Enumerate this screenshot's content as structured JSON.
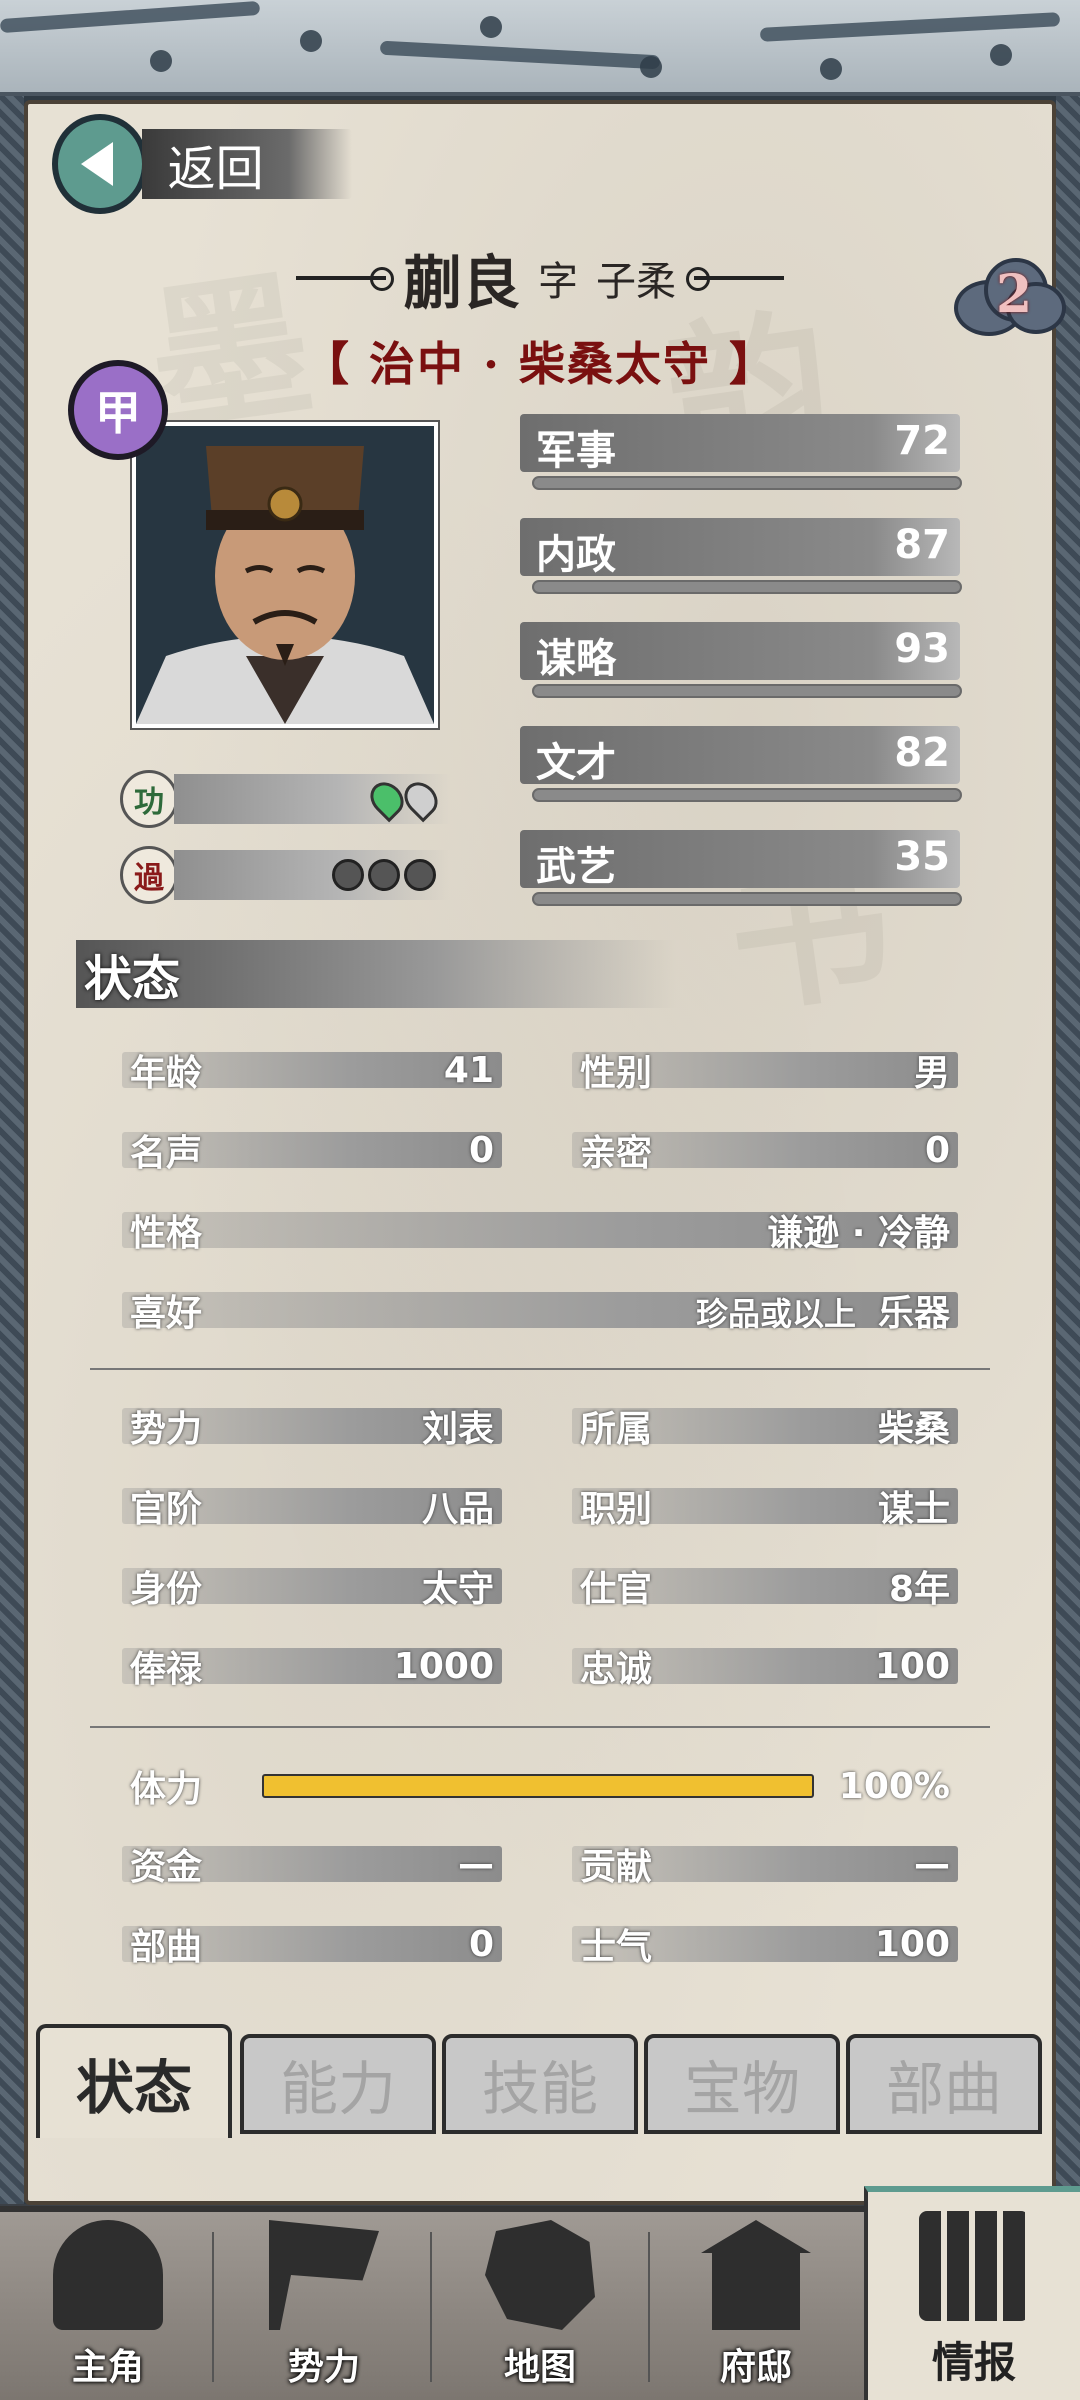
{
  "back_label": "返回",
  "officer": {
    "name": "蒯良",
    "courtesy_prefix": "字",
    "courtesy_name": "子柔",
    "title": "【 治中 · 柴桑太守 】",
    "grade": "甲",
    "badge_count": "2"
  },
  "merit": {
    "label": "功",
    "pins": [
      "green-pin-icon",
      "gray-pin-icon"
    ]
  },
  "demerit": {
    "label": "過",
    "marks": [
      "swirl-icon",
      "swirl-icon",
      "swirl-icon"
    ]
  },
  "abilities": [
    {
      "label": "军事",
      "value": "72"
    },
    {
      "label": "内政",
      "value": "87"
    },
    {
      "label": "谋略",
      "value": "93"
    },
    {
      "label": "文才",
      "value": "82"
    },
    {
      "label": "武艺",
      "value": "35"
    }
  ],
  "status_heading": "状态",
  "status": {
    "age": {
      "label": "年龄",
      "value": "41"
    },
    "gender": {
      "label": "性别",
      "value": "男"
    },
    "fame": {
      "label": "名声",
      "value": "0"
    },
    "intimacy": {
      "label": "亲密",
      "value": "0"
    },
    "personality": {
      "label": "性格",
      "value": "谦逊 · 冷静"
    },
    "hobby": {
      "label": "喜好",
      "value_prefix": "珍品或以上",
      "value": "乐器"
    },
    "faction": {
      "label": "势力",
      "value": "刘表"
    },
    "belong": {
      "label": "所属",
      "value": "柴桑"
    },
    "rank": {
      "label": "官阶",
      "value": "八品"
    },
    "post": {
      "label": "职别",
      "value": "谋士"
    },
    "identity": {
      "label": "身份",
      "value": "太守"
    },
    "service": {
      "label": "仕官",
      "value": "8年"
    },
    "salary": {
      "label": "俸禄",
      "value": "1000"
    },
    "loyalty": {
      "label": "忠诚",
      "value": "100"
    },
    "stamina": {
      "label": "体力",
      "value": "100%",
      "fraction": 1.0
    },
    "funds": {
      "label": "资金",
      "value": "—"
    },
    "contribution": {
      "label": "贡献",
      "value": "—"
    },
    "troops": {
      "label": "部曲",
      "value": "0"
    },
    "morale": {
      "label": "士气",
      "value": "100"
    }
  },
  "tabs": [
    "状态",
    "能力",
    "技能",
    "宝物",
    "部曲"
  ],
  "nav": [
    {
      "label": "主角",
      "icon": "warrior-icon"
    },
    {
      "label": "势力",
      "icon": "flag-icon"
    },
    {
      "label": "地图",
      "icon": "map-icon"
    },
    {
      "label": "府邸",
      "icon": "mansion-icon"
    },
    {
      "label": "情报",
      "icon": "scroll-icon"
    }
  ],
  "colors": {
    "grade": "#9a6fc7",
    "stamina": "#f0c030",
    "title": "#7a1010",
    "back": "#5e9b8f"
  }
}
